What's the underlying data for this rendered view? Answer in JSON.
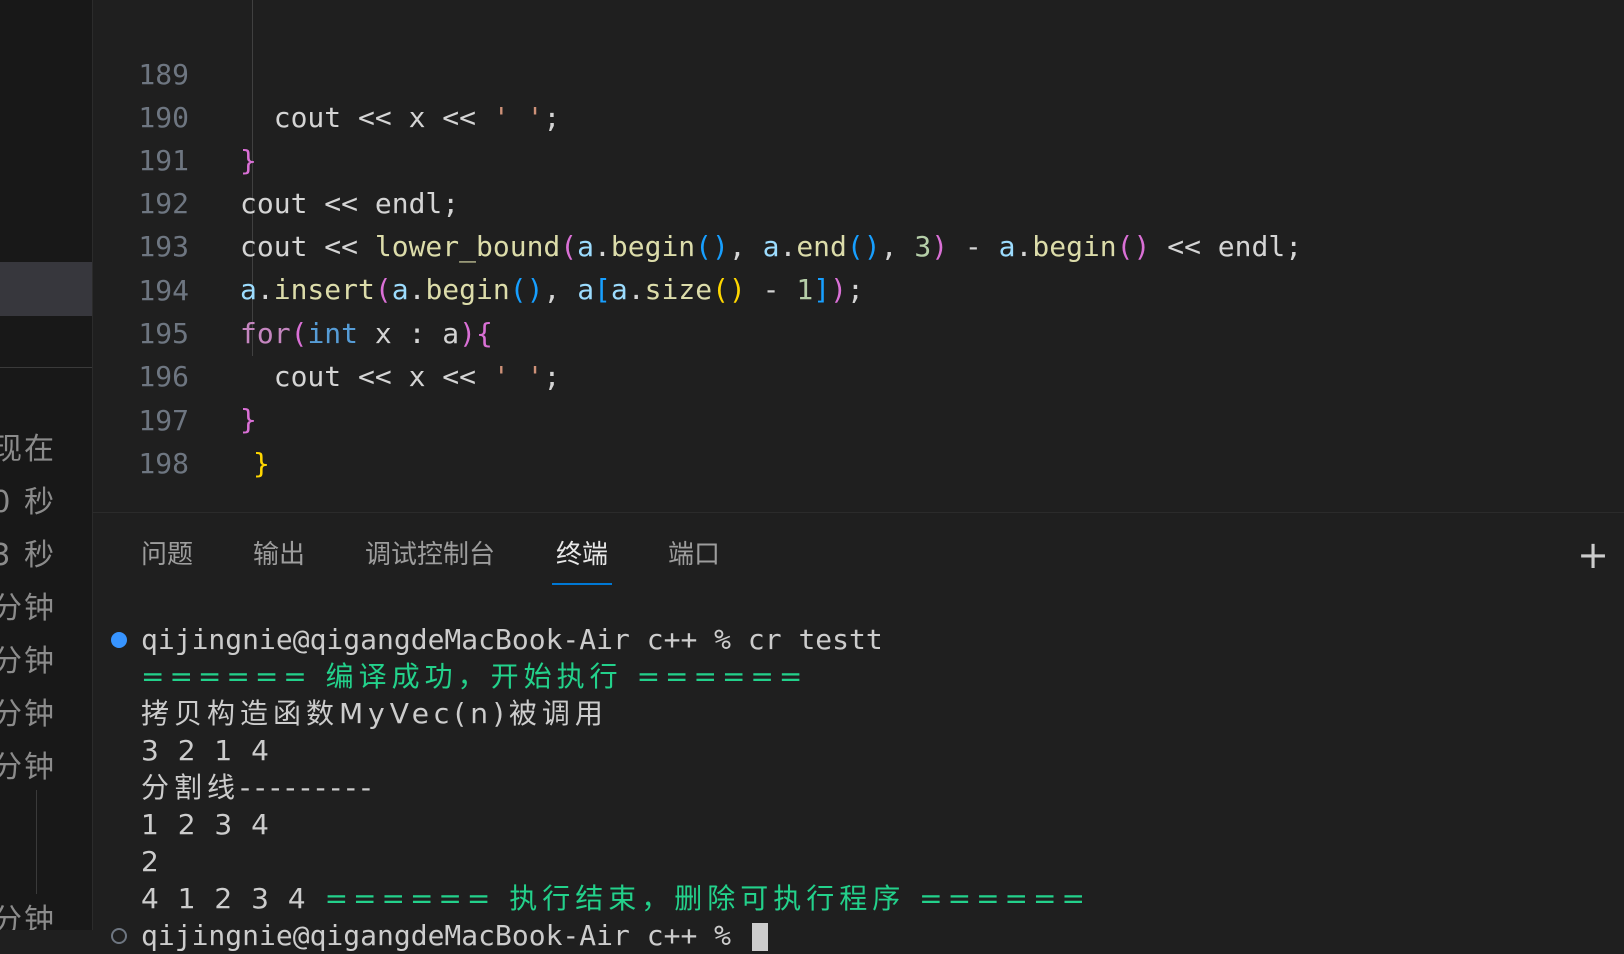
{
  "sidebar": {
    "timeline": [
      "现在",
      "0 秒",
      "3 秒",
      "分钟",
      "分钟",
      "分钟",
      "分钟",
      "分钟"
    ]
  },
  "editor": {
    "lines": [
      {
        "num": "189"
      },
      {
        "num": "190"
      },
      {
        "num": "191"
      },
      {
        "num": "192"
      },
      {
        "num": "193"
      },
      {
        "num": "194"
      },
      {
        "num": "195"
      },
      {
        "num": "196"
      },
      {
        "num": "197"
      },
      {
        "num": "198"
      }
    ]
  },
  "panel": {
    "tabs": [
      "问题",
      "输出",
      "调试控制台",
      "终端",
      "端口"
    ],
    "active_tab": "终端",
    "add_icon": "plus-icon"
  },
  "terminal": {
    "prompt_command": "qijingnie@qigangdeMacBook-Air c++ % cr testt",
    "compile_ok": "====== 编译成功，开始执行 ======",
    "copy_ctor": "拷贝构造函数MyVec(n)被调用",
    "out1": "3 2 1 4",
    "separator": "分割线---------",
    "out2": "1 2 3 4",
    "out3": "2",
    "out4": "4 1 2 3 4 ",
    "exec_end": "====== 执行结束，删除可执行程序 ======",
    "prompt2": "qijingnie@qigangdeMacBook-Air c++ % "
  },
  "colors": {
    "accent": "#0078d4",
    "terminal_green": "#23d18b",
    "status_dot": "#3794ff"
  }
}
